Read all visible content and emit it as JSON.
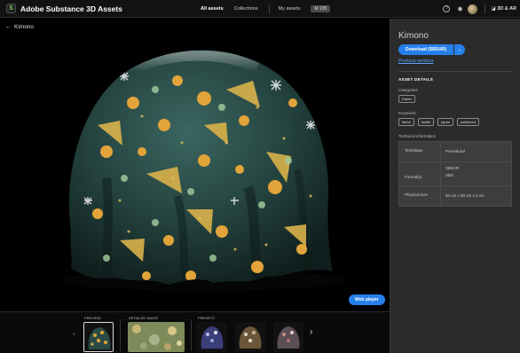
{
  "header": {
    "logo_glyph": "S",
    "app_title": "Adobe Substance 3D Assets",
    "nav": [
      "All assets",
      "Collections",
      "My assets"
    ],
    "nav_chip": "M 195",
    "right_label": "3D & AR"
  },
  "viewer": {
    "back_label": "Kimono",
    "web_player_label": "Web player"
  },
  "strip": {
    "labels": [
      "PREVIEW",
      "DETAILED IMAGE",
      "PRESETS"
    ],
    "prev_arrow": "‹",
    "next_arrow": "›"
  },
  "panel": {
    "title": "Kimono",
    "download_label": "Download (SBSAR)",
    "download_caret": "⌄",
    "previous_versions": "Previous versions",
    "section_title": "ASSET DETAILS",
    "categories_label": "Categories",
    "categories": [
      "Fabric"
    ],
    "keywords_label": "Keywords",
    "keywords": [
      "fabric",
      "textile",
      "japan",
      "patterned"
    ],
    "tech_label": "Technical information",
    "tech": [
      {
        "key": "Technique",
        "value": "Procedural"
      },
      {
        "key": "Format(s)",
        "value": "SBSAR",
        "value2": "SBS"
      },
      {
        "key": "Physical size",
        "value": "60 cm x 60 cm x 2 cm"
      }
    ]
  },
  "colors": {
    "accent": "#2680eb",
    "link": "#5fa4ff",
    "panel_bg": "#2b2b2b",
    "fabric_base": "#25433f",
    "flower_gold": "#e2a43a",
    "fan_gold": "#d9b24a"
  }
}
